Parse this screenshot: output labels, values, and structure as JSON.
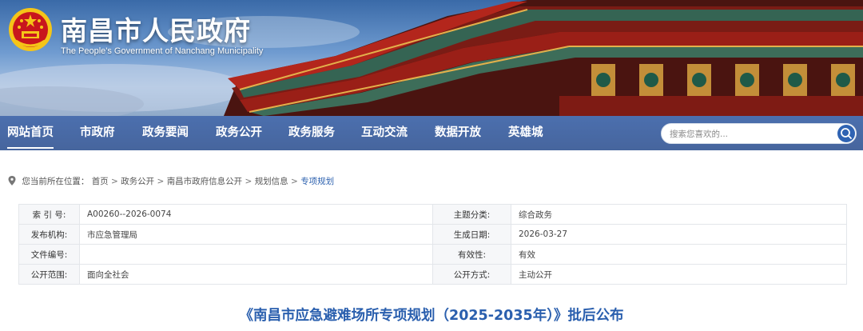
{
  "header": {
    "title": "南昌市人民政府",
    "subtitle": "The People's Government of Nanchang Municipality"
  },
  "nav": {
    "items": [
      {
        "label": "网站首页",
        "active": true
      },
      {
        "label": "市政府",
        "active": false
      },
      {
        "label": "政务要闻",
        "active": false
      },
      {
        "label": "政务公开",
        "active": false
      },
      {
        "label": "政务服务",
        "active": false
      },
      {
        "label": "互动交流",
        "active": false
      },
      {
        "label": "数据开放",
        "active": false
      },
      {
        "label": "英雄城",
        "active": false
      }
    ]
  },
  "search": {
    "placeholder": "搜索您喜欢的...",
    "icon": "search-icon"
  },
  "breadcrumb": {
    "prefix": "您当前所在位置：",
    "items": [
      "首页",
      "政务公开",
      "南昌市政府信息公开",
      "规划信息",
      "专项规划"
    ],
    "separator": ">",
    "icon": "location-pin-icon"
  },
  "metadata": {
    "rows": [
      {
        "label1": "索 引 号:",
        "value1": "A00260--2026-0074",
        "label2": "主题分类:",
        "value2": "综合政务"
      },
      {
        "label1": "发布机构:",
        "value1": "市应急管理局",
        "label2": "生成日期:",
        "value2": "2026-03-27"
      },
      {
        "label1": "文件编号:",
        "value1": "",
        "label2": "有效性:",
        "value2": "有效"
      },
      {
        "label1": "公开范围:",
        "value1": "面向全社会",
        "label2": "公开方式:",
        "value2": "主动公开"
      }
    ]
  },
  "article": {
    "title": "《南昌市应急避难场所专项规划（2025-2035年）》批后公布"
  },
  "colors": {
    "nav_bg": "#2c56a0",
    "link_blue": "#2a5fae",
    "emblem_red": "#c8161d",
    "emblem_gold": "#f5c518"
  }
}
